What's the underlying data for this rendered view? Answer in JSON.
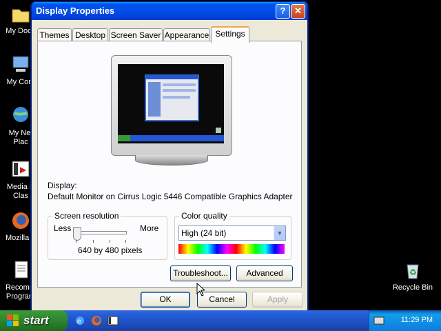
{
  "desktop": {
    "icons": [
      {
        "label": "My Docu",
        "icon": "folder-icon"
      },
      {
        "label": "My Com",
        "icon": "computer-icon"
      },
      {
        "label": "My Net\nPlac",
        "icon": "network-icon"
      },
      {
        "label": "Media P\nClas",
        "icon": "media-player-icon"
      },
      {
        "label": "Mozilla F",
        "icon": "firefox-icon"
      },
      {
        "label": "Recomm\nProgram",
        "icon": "document-icon"
      }
    ],
    "recycle_bin": "Recycle Bin"
  },
  "window": {
    "title": "Display Properties",
    "help_glyph": "?",
    "close_glyph": "✕",
    "tabs": [
      "Themes",
      "Desktop",
      "Screen Saver",
      "Appearance",
      "Settings"
    ],
    "active_tab": "Settings",
    "display_label": "Display:",
    "display_value": "Default Monitor on Cirrus Logic 5446 Compatible Graphics Adapter",
    "resolution": {
      "group_title": "Screen resolution",
      "less": "Less",
      "more": "More",
      "value": "640 by 480 pixels",
      "slider_position": 0
    },
    "color": {
      "group_title": "Color quality",
      "selected": "High (24 bit)"
    },
    "buttons": {
      "troubleshoot": "Troubleshoot...",
      "advanced": "Advanced",
      "ok": "OK",
      "cancel": "Cancel",
      "apply": "Apply"
    }
  },
  "taskbar": {
    "start": "start",
    "clock": "11:29 PM"
  },
  "colors": {
    "titlebar": "#0050ee",
    "dialog_bg": "#ece9d8",
    "taskbar": "#245edb",
    "start": "#2f8a2f"
  }
}
